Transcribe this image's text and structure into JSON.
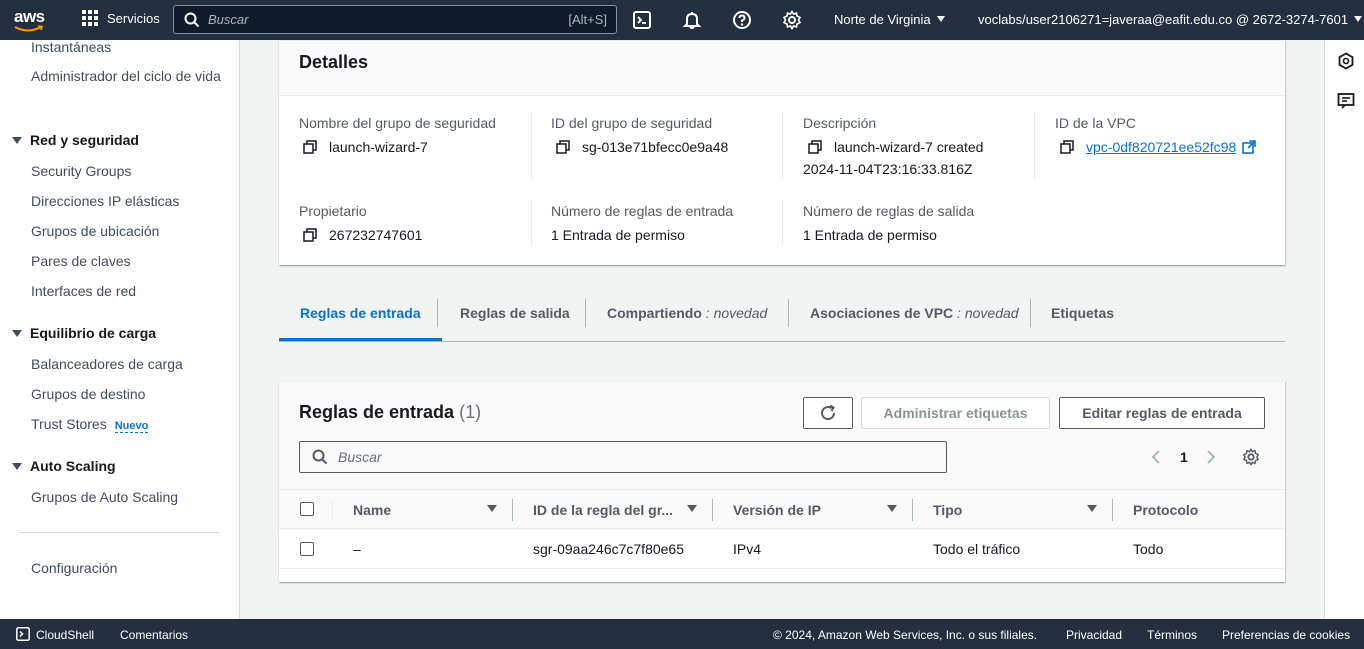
{
  "topnav": {
    "logo_text": "aws",
    "services_label": "Servicios",
    "search_placeholder": "Buscar",
    "search_shortcut": "[Alt+S]",
    "region_label": "Norte de Virginia",
    "account_label": "voclabs/user2106271=javeraa@eafit.edu.co @ 2672-3274-7601"
  },
  "sidebar": {
    "top_items": [
      "Instantáneas",
      "Administrador del ciclo de vida"
    ],
    "sections": [
      {
        "title": "Red y seguridad",
        "items": [
          "Security Groups",
          "Direcciones IP elásticas",
          "Grupos de ubicación",
          "Pares de claves",
          "Interfaces de red"
        ]
      },
      {
        "title": "Equilibrio de carga",
        "items": [
          "Balanceadores de carga",
          "Grupos de destino",
          "Trust Stores"
        ]
      },
      {
        "title": "Auto Scaling",
        "items": [
          "Grupos de Auto Scaling"
        ]
      }
    ],
    "new_badge": "Nuevo",
    "config_label": "Configuración"
  },
  "details": {
    "title": "Detalles",
    "fields": [
      {
        "label": "Nombre del grupo de seguridad",
        "value": "launch-wizard-7"
      },
      {
        "label": "ID del grupo de seguridad",
        "value": "sg-013e71bfecc0e9a48"
      },
      {
        "label": "Descripción",
        "value_line1": "launch-wizard-7 created",
        "value_line2": "2024-11-04T23:16:33.816Z"
      },
      {
        "label": "ID de la VPC",
        "value": "vpc-0df820721ee52fc98"
      },
      {
        "label": "Propietario",
        "value": "267232747601"
      },
      {
        "label": "Número de reglas de entrada",
        "value": "1 Entrada de permiso"
      },
      {
        "label": "Número de reglas de salida",
        "value": "1 Entrada de permiso"
      }
    ]
  },
  "tabs": [
    {
      "label": "Reglas de entrada",
      "active": true
    },
    {
      "label": "Reglas de salida"
    },
    {
      "label": "Compartiendo",
      "suffix": "novedad"
    },
    {
      "label": "Asociaciones de VPC",
      "suffix": "novedad"
    },
    {
      "label": "Etiquetas"
    }
  ],
  "tab_suffix_sep": " : ",
  "rules": {
    "title": "Reglas de entrada",
    "count": "(1)",
    "manage_tags_label": "Administrar etiquetas",
    "edit_rules_label": "Editar reglas de entrada",
    "search_placeholder": "Buscar",
    "page_number": "1",
    "columns": [
      "Name",
      "ID de la regla del gr...",
      "Versión de IP",
      "Tipo",
      "Protocolo"
    ],
    "rows": [
      {
        "name": "–",
        "rule_id": "sgr-09aa246c7c7f80e65",
        "ip_version": "IPv4",
        "type": "Todo el tráfico",
        "protocol": "Todo"
      }
    ]
  },
  "footer": {
    "cloudshell": "CloudShell",
    "feedback": "Comentarios",
    "copyright": "© 2024, Amazon Web Services, Inc. o sus filiales.",
    "privacy": "Privacidad",
    "terms": "Términos",
    "cookies": "Preferencias de cookies"
  },
  "colors": {
    "nav_bg": "#232f3e",
    "accent": "#0972d3",
    "aws_orange": "#ff9900"
  },
  "icons": [
    "grid-icon",
    "search-icon",
    "cloudshell-icon",
    "bell-icon",
    "help-icon",
    "gear-icon",
    "copy-icon",
    "external-link-icon",
    "refresh-icon",
    "chevron-left-icon",
    "chevron-right-icon",
    "sort-icon",
    "hexagon-icon",
    "feedback-icon"
  ]
}
